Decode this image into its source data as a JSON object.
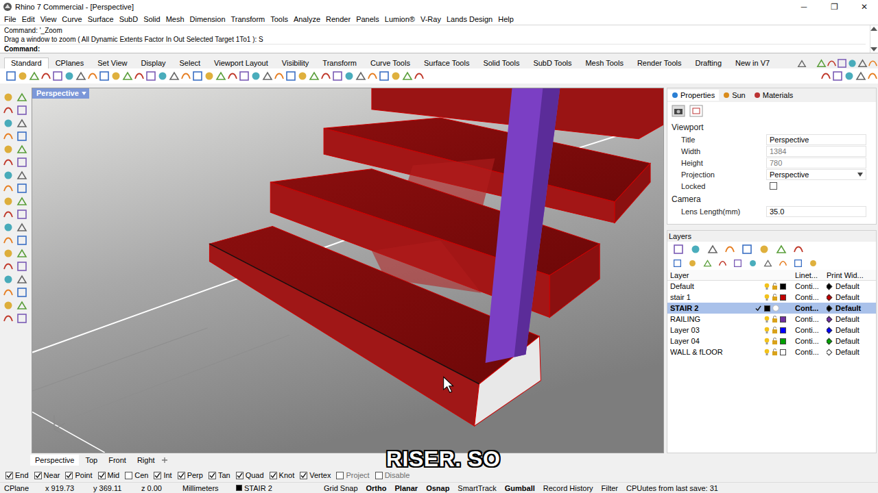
{
  "window": {
    "title": "Rhino 7 Commercial - [Perspective]",
    "controls": [
      "─",
      "❐",
      "✕"
    ]
  },
  "menu": [
    "File",
    "Edit",
    "View",
    "Curve",
    "Surface",
    "SubD",
    "Solid",
    "Mesh",
    "Dimension",
    "Transform",
    "Tools",
    "Analyze",
    "Render",
    "Panels",
    "Lumion®",
    "V-Ray",
    "Lands Design",
    "Help"
  ],
  "command": {
    "history": [
      "Command: '_Zoom",
      "Drag a window to zoom ( All  Dynamic  Extents  Factor  In  Out  Selected  Target  1To1 ): S"
    ],
    "prompt": "Command:"
  },
  "toolbar_tabs": [
    {
      "label": "Standard",
      "selected": true
    },
    {
      "label": "CPlanes",
      "selected": false
    },
    {
      "label": "Set View",
      "selected": false
    },
    {
      "label": "Display",
      "selected": false
    },
    {
      "label": "Select",
      "selected": false
    },
    {
      "label": "Viewport Layout",
      "selected": false
    },
    {
      "label": "Visibility",
      "selected": false
    },
    {
      "label": "Transform",
      "selected": false
    },
    {
      "label": "Curve Tools",
      "selected": false
    },
    {
      "label": "Surface Tools",
      "selected": false
    },
    {
      "label": "Solid Tools",
      "selected": false
    },
    {
      "label": "SubD Tools",
      "selected": false
    },
    {
      "label": "Mesh Tools",
      "selected": false
    },
    {
      "label": "Render Tools",
      "selected": false
    },
    {
      "label": "Drafting",
      "selected": false
    },
    {
      "label": "New in V7",
      "selected": false
    }
  ],
  "viewport": {
    "title": "Perspective"
  },
  "viewport_tabs": [
    {
      "label": "Perspective",
      "selected": true
    },
    {
      "label": "Top",
      "selected": false
    },
    {
      "label": "Front",
      "selected": false
    },
    {
      "label": "Right",
      "selected": false
    }
  ],
  "osnaps": [
    {
      "label": "End",
      "checked": true
    },
    {
      "label": "Near",
      "checked": true
    },
    {
      "label": "Point",
      "checked": true
    },
    {
      "label": "Mid",
      "checked": true
    },
    {
      "label": "Cen",
      "checked": false
    },
    {
      "label": "Int",
      "checked": true
    },
    {
      "label": "Perp",
      "checked": true
    },
    {
      "label": "Tan",
      "checked": true
    },
    {
      "label": "Quad",
      "checked": true
    },
    {
      "label": "Knot",
      "checked": true
    },
    {
      "label": "Vertex",
      "checked": true
    },
    {
      "label": "Project",
      "checked": false
    },
    {
      "label": "Disable",
      "checked": false
    }
  ],
  "caption": "RISER. SO",
  "properties": {
    "tabs": [
      {
        "label": "Properties",
        "selected": true
      },
      {
        "label": "Sun",
        "selected": false
      },
      {
        "label": "Materials",
        "selected": false
      }
    ],
    "section": "Viewport",
    "rows": [
      {
        "label": "Title",
        "value": "Perspective",
        "kind": "text",
        "disabled": false
      },
      {
        "label": "Width",
        "value": "1384",
        "kind": "text",
        "disabled": true
      },
      {
        "label": "Height",
        "value": "780",
        "kind": "text",
        "disabled": true
      },
      {
        "label": "Projection",
        "value": "Perspective",
        "kind": "select",
        "disabled": false
      },
      {
        "label": "Locked",
        "value": "",
        "kind": "checkbox",
        "disabled": false,
        "checked": false
      }
    ],
    "camera_section": "Camera",
    "camera_rows": [
      {
        "label": "Lens Length(mm)",
        "value": "35.0",
        "kind": "text",
        "disabled": false
      }
    ]
  },
  "layers": {
    "title": "Layers",
    "columns": [
      "Layer",
      "Linet...",
      "Print Wid..."
    ],
    "rows": [
      {
        "name": "Default",
        "selected": false,
        "current": false,
        "color": "#000000",
        "linetype": "Conti...",
        "print_width": "Default"
      },
      {
        "name": "stair 1",
        "selected": false,
        "current": false,
        "color": "#c00000",
        "linetype": "Conti...",
        "print_width": "Default"
      },
      {
        "name": "STAIR 2",
        "selected": true,
        "current": true,
        "color": "#000000",
        "linetype": "Cont...",
        "print_width": "Default"
      },
      {
        "name": "RAILING",
        "selected": false,
        "current": false,
        "color": "#7030a0",
        "linetype": "Conti...",
        "print_width": "Default"
      },
      {
        "name": "Layer 03",
        "selected": false,
        "current": false,
        "color": "#0000ff",
        "linetype": "Conti...",
        "print_width": "Default"
      },
      {
        "name": "Layer 04",
        "selected": false,
        "current": false,
        "color": "#00a000",
        "linetype": "Conti...",
        "print_width": "Default"
      },
      {
        "name": "WALL & fLOOR",
        "selected": false,
        "current": false,
        "color": "#ffffff",
        "linetype": "Conti...",
        "print_width": "Default"
      }
    ]
  },
  "status_bar": {
    "cplane": "CPlane",
    "x": "x 919.73",
    "y": "y 369.11",
    "z": "z 0.00",
    "units": "Millimeters",
    "layer": {
      "name": "STAIR 2",
      "color": "#000000"
    },
    "toggles": [
      {
        "label": "Grid Snap",
        "on": false
      },
      {
        "label": "Ortho",
        "on": true
      },
      {
        "label": "Planar",
        "on": true
      },
      {
        "label": "Osnap",
        "on": true
      },
      {
        "label": "SmartTrack",
        "on": false
      },
      {
        "label": "Gumball",
        "on": true
      },
      {
        "label": "Record History",
        "on": false
      },
      {
        "label": "Filter",
        "on": false
      }
    ],
    "info": "CPUutes from last save: 31"
  }
}
